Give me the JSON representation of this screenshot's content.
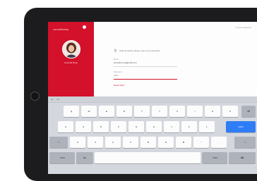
{
  "sidebar": {
    "brand": "consultancy",
    "profile_name": "Amanda Rose"
  },
  "main": {
    "header_link": "Forgot password",
    "message": "Hello Amanda, please enter your password",
    "email_label": "Email",
    "email_value": "amanda.rose@mail.com",
    "password_label": "Password",
    "password_value": "••••••",
    "forgot_link": "Need help?"
  },
  "keyboard": {
    "row1": [
      "Q",
      "W",
      "E",
      "R",
      "T",
      "Y",
      "U",
      "I",
      "O",
      "P"
    ],
    "row2": [
      "A",
      "S",
      "D",
      "F",
      "G",
      "H",
      "J",
      "K",
      "L"
    ],
    "row3": [
      "Z",
      "X",
      "C",
      "V",
      "B",
      "N",
      "M",
      "!",
      ","
    ],
    "backspace": "⌫",
    "return": "return",
    "shift_left": "⇧",
    "shift_right": "⇧",
    "numbers_left": ".?123",
    "numbers_right": ".?123",
    "space": "",
    "dismiss": "⌨",
    "tab": "tab"
  },
  "colors": {
    "brand_red": "#d3112b",
    "return_blue": "#2f7df6"
  },
  "icons": {
    "brand": "brand-mark-icon",
    "message": "user-icon",
    "undo": "undo-icon",
    "redo": "redo-icon"
  }
}
